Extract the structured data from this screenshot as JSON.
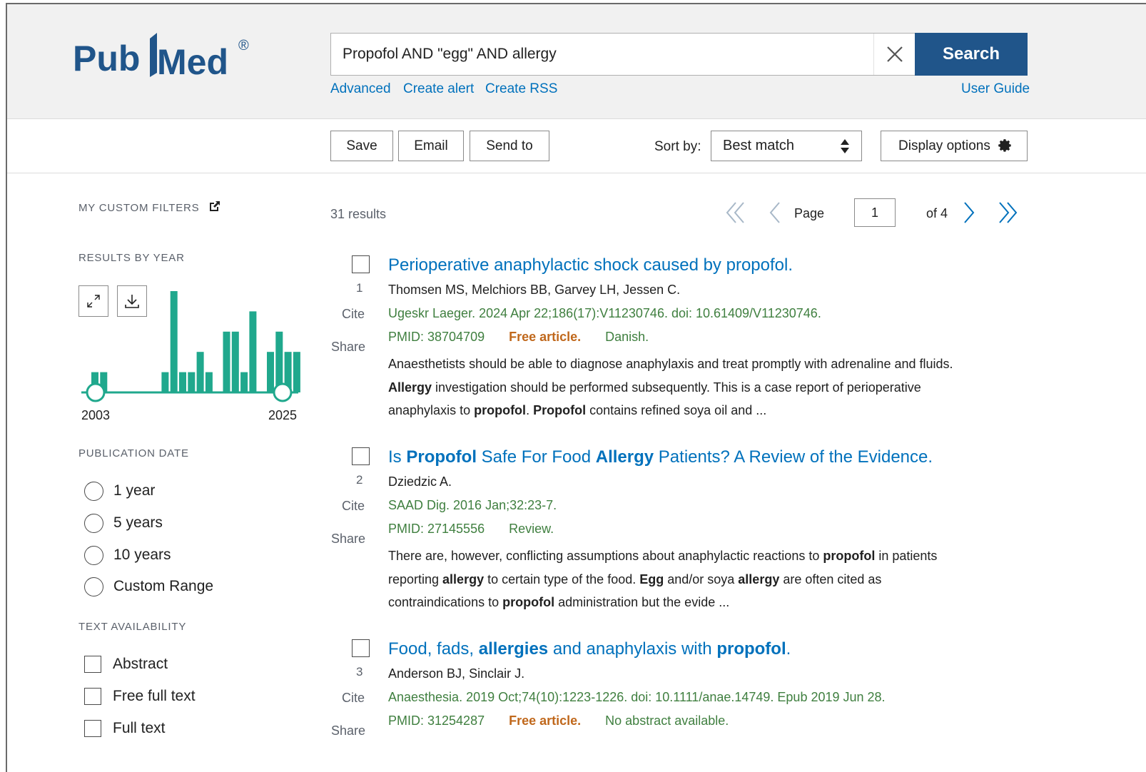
{
  "app": {
    "logo_text_left": "Pub",
    "logo_text_right": "Med",
    "logo_mark": "®"
  },
  "search": {
    "value": "Propofol AND \"egg\" AND allergy",
    "button_label": "Search",
    "links": [
      "Advanced",
      "Create alert",
      "Create RSS"
    ],
    "user_guide": "User Guide"
  },
  "toolbar": {
    "save": "Save",
    "email": "Email",
    "send_to": "Send to",
    "sort_label": "Sort by:",
    "sort_value": "Best match",
    "display_options": "Display options"
  },
  "sidebar": {
    "custom_filters": "MY CUSTOM FILTERS",
    "results_by_year": "RESULTS BY YEAR",
    "year_start": "2003",
    "year_end": "2025",
    "publication_date": "PUBLICATION DATE",
    "date_options": [
      "1 year",
      "5 years",
      "10 years",
      "Custom Range"
    ],
    "text_availability": "TEXT AVAILABILITY",
    "text_options": [
      "Abstract",
      "Free full text",
      "Full text"
    ]
  },
  "histogram": {
    "bars": [
      1,
      1,
      0,
      0,
      0,
      0,
      0,
      0,
      1,
      5,
      1,
      1,
      2,
      1,
      0,
      3,
      3,
      1,
      4,
      0,
      2,
      3,
      2,
      2
    ]
  },
  "pagination": {
    "results": "31 results",
    "page_label": "Page",
    "current_page": "1",
    "of_label": "of 4"
  },
  "results": [
    {
      "num": "1",
      "title_parts": [
        [
          "",
          "Perioperative anaphylactic shock caused by propofol."
        ]
      ],
      "authors": "Thomsen MS, Melchiors BB, Garvey LH, Jessen C.",
      "citation": "Ugeskr Laeger. 2024 Apr 22;186(17):V11230746. doi: 10.61409/V11230746.",
      "pmid": "PMID: 38704709",
      "free": "Free article.",
      "tag": "Danish.",
      "snippet_lines": [
        [
          [
            "",
            "Anaesthetists should be able to diagnose anaphylaxis and treat promptly with adrenaline and fluids."
          ]
        ],
        [
          [
            "b",
            "Allergy"
          ],
          [
            "",
            " investigation should be performed subsequently. This is a case report of perioperative"
          ]
        ],
        [
          [
            "",
            "anaphylaxis to "
          ],
          [
            "b",
            "propofol"
          ],
          [
            "",
            ". "
          ],
          [
            "b",
            "Propofol"
          ],
          [
            "",
            " contains refined soya oil and ..."
          ]
        ]
      ]
    },
    {
      "num": "2",
      "title_parts": [
        [
          "",
          "Is "
        ],
        [
          "b",
          "Propofol"
        ],
        [
          "",
          " Safe For Food "
        ],
        [
          "b",
          "Allergy"
        ],
        [
          "",
          " Patients? A Review of the Evidence."
        ]
      ],
      "authors": "Dziedzic A.",
      "citation": "SAAD Dig. 2016 Jan;32:23-7.",
      "pmid": "PMID: 27145556",
      "free": "",
      "tag": "Review.",
      "snippet_lines": [
        [
          [
            "",
            "There are, however, conflicting assumptions about anaphylactic reactions to "
          ],
          [
            "b",
            "propofol"
          ],
          [
            "",
            " in patients"
          ]
        ],
        [
          [
            "",
            "reporting "
          ],
          [
            "b",
            "allergy"
          ],
          [
            "",
            " to certain type of the food. "
          ],
          [
            "b",
            "Egg"
          ],
          [
            "",
            " and/or soya "
          ],
          [
            "b",
            "allergy"
          ],
          [
            "",
            " are often cited as"
          ]
        ],
        [
          [
            "",
            "contraindications to "
          ],
          [
            "b",
            "propofol"
          ],
          [
            "",
            " administration but the evide ..."
          ]
        ]
      ]
    },
    {
      "num": "3",
      "title_parts": [
        [
          "",
          "Food, fads, "
        ],
        [
          "b",
          "allergies"
        ],
        [
          "",
          " and anaphylaxis with "
        ],
        [
          "b",
          "propofol"
        ],
        [
          "",
          "."
        ]
      ],
      "authors": "Anderson BJ, Sinclair J.",
      "citation": "Anaesthesia. 2019 Oct;74(10):1223-1226. doi: 10.1111/anae.14749. Epub 2019 Jun 28.",
      "pmid": "PMID: 31254287",
      "free": "Free article.",
      "tag": "No abstract available.",
      "snippet_lines": []
    }
  ],
  "labels": {
    "cite": "Cite",
    "share": "Share"
  },
  "colors": {
    "brand": "#20558a",
    "link": "#0071bc",
    "histogram": "#20a88d",
    "free_article": "#c0681c",
    "citation": "#3f7f3f"
  }
}
